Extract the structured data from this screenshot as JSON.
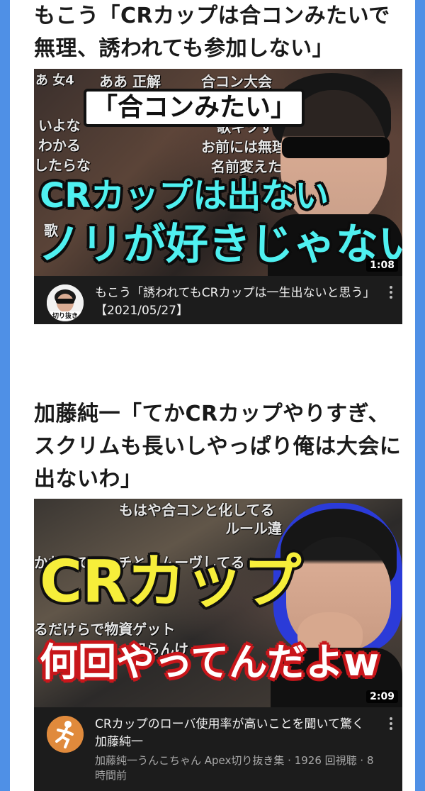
{
  "colors": {
    "background_blue": "#4f90e6",
    "page": "#ffffff",
    "card_meta": "#1c1c1c",
    "caption_cyan": "#4ff0f0",
    "caption_yellow": "#f6ee3a",
    "caption_red": "#c8161b"
  },
  "article1": {
    "headline_line1": "もこう「CRカップは合コンみたいで",
    "headline_line2": "無理、誘われても参加しない」",
    "thumbnail": {
      "captions": [
        "「合コンみたい」",
        "CRカップは出ない",
        "ノリが好きじゃない"
      ],
      "background_texts": [
        "ああ 正解",
        "合コン大会",
        "あ 女4",
        "いよな",
        "わかる",
        "したらな",
        "歌キツすぎ",
        "お前には無理",
        "名前変えたら",
        "歌"
      ],
      "duration": "1:08"
    },
    "video": {
      "avatar_label": "切り抜き",
      "avatar_icon": "sunglasses-face-icon",
      "title": "もこう「誘われてもCRカップは一生出ないと思う」【2021/05/27】",
      "menu_icon": "more-vert-icon"
    }
  },
  "article2": {
    "headline_line1": "加藤純一「てかCRカップやりすぎ、",
    "headline_line2": "スクリムも長いしやっぱり俺は大会に",
    "headline_line3": "出ないわ」",
    "thumbnail": {
      "captions": [
        "CRカップ",
        "何回やってんだよw"
      ],
      "background_texts": [
        "もはや合コンと化してる",
        "ルール違",
        "かわってアンチとるムーヴしてる",
        "るだけらで物資ゲット",
        "知らんけ"
      ],
      "duration": "2:09"
    },
    "video": {
      "avatar_icon": "running-figure-icon",
      "title": "CRカップのローバ使用率が高いことを聞いて驚く加藤純一",
      "channel_line": "加藤純一うんこちゃん Apex切り抜き集 · 1926 回視聴 · 8 時間前",
      "menu_icon": "more-vert-icon"
    }
  }
}
